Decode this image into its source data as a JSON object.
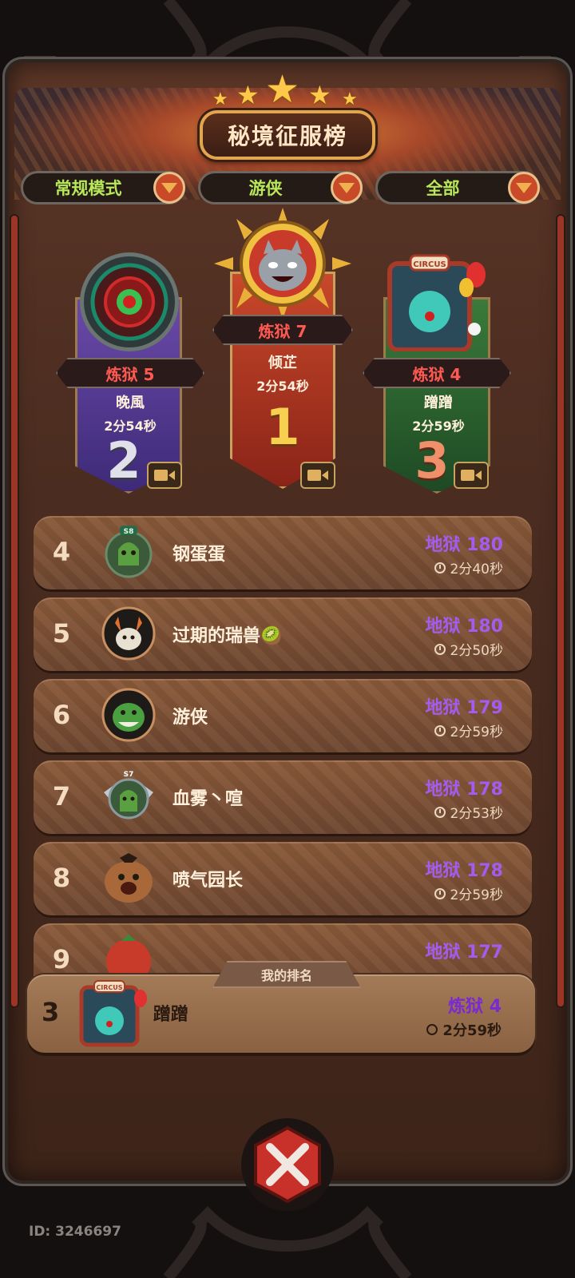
{
  "header": {
    "title": "秘境征服榜"
  },
  "filters": [
    {
      "label": "常规模式"
    },
    {
      "label": "游侠"
    },
    {
      "label": "全部"
    }
  ],
  "podium": {
    "first": {
      "rank_label": "炼狱 7",
      "name": "倾芷",
      "time": "2分54秒",
      "place": "1"
    },
    "second": {
      "rank_label": "炼狱 5",
      "name": "晚風",
      "time": "2分54秒",
      "place": "2"
    },
    "third": {
      "rank_label": "炼狱 4",
      "name": "蹭蹭",
      "time": "2分59秒",
      "place": "3"
    }
  },
  "list": [
    {
      "rank": "4",
      "name": "钢蛋蛋",
      "level": "地狱 180",
      "time": "2分40秒",
      "badge": "S8"
    },
    {
      "rank": "5",
      "name": "过期的瑞兽🥝",
      "level": "地狱 180",
      "time": "2分50秒"
    },
    {
      "rank": "6",
      "name": "游侠",
      "level": "地狱 179",
      "time": "2分59秒"
    },
    {
      "rank": "7",
      "name": "血雾丶喧",
      "level": "地狱 178",
      "time": "2分53秒",
      "badge": "S7"
    },
    {
      "rank": "8",
      "name": "喷气园长",
      "level": "地狱 178",
      "time": "2分59秒"
    },
    {
      "rank": "9",
      "name": "",
      "level": "地狱 177",
      "time": ""
    }
  ],
  "my_rank": {
    "tab_label": "我的排名",
    "rank": "3",
    "name": "蹭蹭",
    "level": "炼狱 4",
    "time": "2分59秒",
    "badge": "CIRCUS"
  },
  "footer": {
    "uid": "ID: 3246697"
  },
  "colors": {
    "level_purple": "#a35cf0",
    "rank_red": "#ff5a52",
    "filter_green": "#b8e85a"
  }
}
